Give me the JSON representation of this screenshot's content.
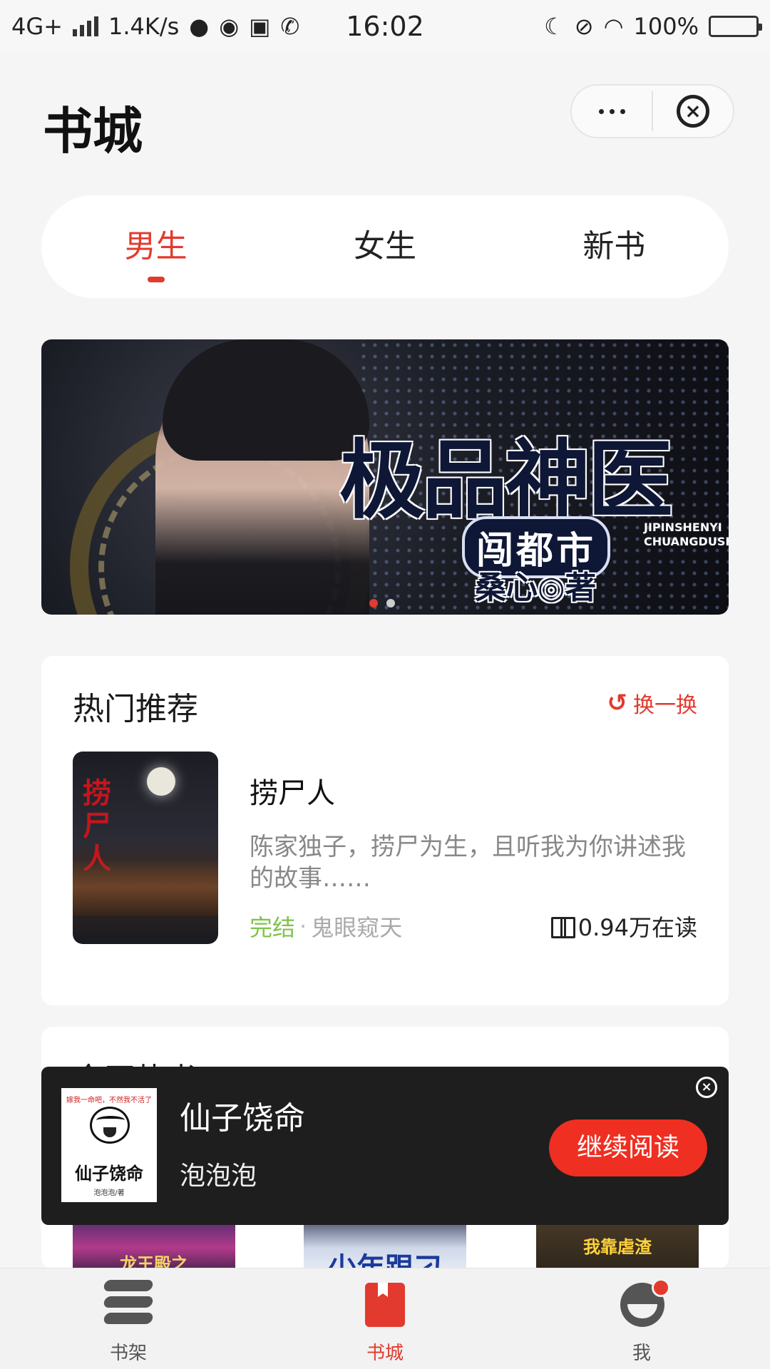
{
  "status_bar": {
    "network": "4G+",
    "speed": "1.4K/s",
    "time": "16:02",
    "battery": "100%"
  },
  "header": {
    "title": "书城"
  },
  "tabs": [
    {
      "label": "男生",
      "active": true
    },
    {
      "label": "女生",
      "active": false
    },
    {
      "label": "新书",
      "active": false
    }
  ],
  "banner": {
    "title": "极品神医",
    "subtitle": "闯都市",
    "pinyin_line1": "JIPINSHENYI",
    "pinyin_line2": "CHUANGDUSHI",
    "author": "桑心◎著",
    "indicator_count": 2,
    "active_index": 0
  },
  "hot_recommend": {
    "title": "热门推荐",
    "refresh_label": "换一换",
    "book": {
      "cover_title": "捞尸人",
      "name": "捞尸人",
      "description": "陈家独子，捞尸为生，且听我为你讲述我的故事……",
      "status": "完结",
      "separator": "·",
      "author": "鬼眼窥天",
      "readers": "0.94万在读"
    }
  },
  "all_net_hot": {
    "title": "全网热书",
    "covers": [
      {
        "caption": "龙王殿之"
      },
      {
        "caption": "少年跟刁"
      },
      {
        "caption": "我靠虐渣"
      }
    ]
  },
  "continue_reading": {
    "cover_tagline": "嫁我一命吧，不然我不活了",
    "cover_title": "仙子饶命",
    "cover_author": "泡泡泡/著",
    "title": "仙子饶命",
    "author": "泡泡泡",
    "button_label": "继续阅读"
  },
  "bottom_nav": [
    {
      "label": "书架",
      "icon": "bookshelf-icon",
      "active": false
    },
    {
      "label": "书城",
      "icon": "bookstore-icon",
      "active": true
    },
    {
      "label": "我",
      "icon": "profile-icon",
      "active": false,
      "badge": true
    }
  ],
  "colors": {
    "accent": "#e23a2e",
    "status_done": "#7cc34a",
    "background": "#f5f5f5"
  }
}
